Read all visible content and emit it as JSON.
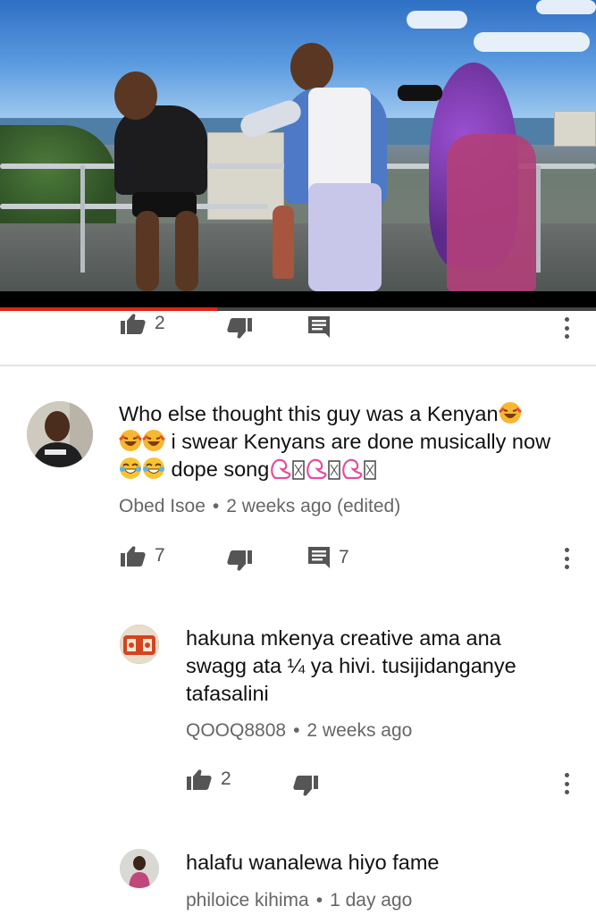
{
  "video": {
    "progress_fraction": 0.365
  },
  "video_actions": {
    "like_count": "2"
  },
  "comments": [
    {
      "text_parts": [
        "Who else thought this guy was a Kenyan",
        "i swear Kenyans are done musically now",
        "dope song"
      ],
      "author": "Obed Isoe",
      "time": "2 weeks ago (edited)",
      "like_count": "7",
      "reply_count": "7"
    },
    {
      "text": "hakuna mkenya creative ama ana swagg ata ¼ ya hivi. tusijidanganye tafasalini",
      "author": "QOOQ8808",
      "time": "2 weeks ago",
      "like_count": "2"
    },
    {
      "text": "halafu wanalewa hiyo fame",
      "author": "philoice kihima",
      "time": "1 day ago"
    }
  ],
  "separator": "•",
  "colors": {
    "progress": "#e0251b",
    "icon": "#555555",
    "meta_text": "#666666",
    "body_text": "#111111"
  },
  "icons": [
    "thumb-up-icon",
    "thumb-down-icon",
    "comment-icon",
    "more-vertical-icon",
    "laughing-emoji-icon",
    "crying-laughing-emoji-icon",
    "flexed-biceps-emoji-icon"
  ]
}
